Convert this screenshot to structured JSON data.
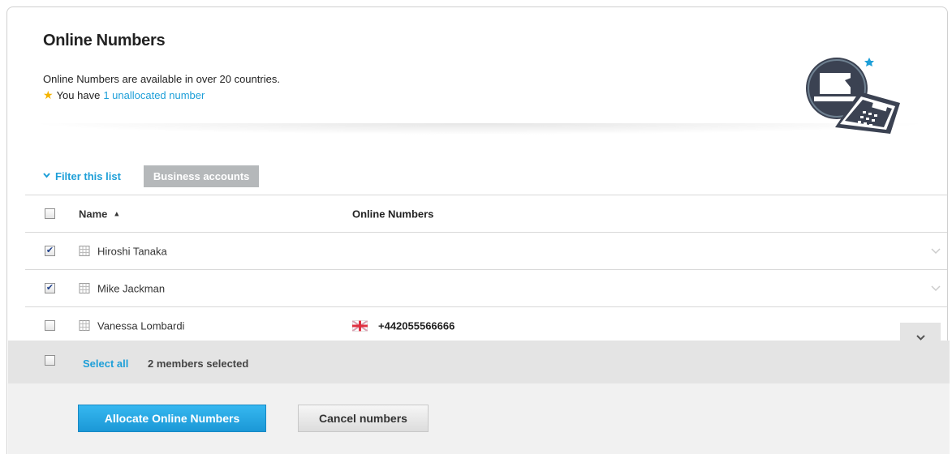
{
  "header": {
    "title": "Online Numbers",
    "description": "Online Numbers are available in over 20 countries.",
    "unallocated_prefix": "You have",
    "unallocated_link": "1 unallocated number"
  },
  "filter": {
    "label": "Filter this list",
    "tag": "Business accounts"
  },
  "table": {
    "columns": {
      "name": "Name",
      "numbers": "Online Numbers"
    },
    "rows": [
      {
        "name": "Hiroshi Tanaka",
        "checked": true,
        "number": ""
      },
      {
        "name": "Mike Jackman",
        "checked": true,
        "number": ""
      },
      {
        "name": "Vanessa Lombardi",
        "checked": false,
        "number": "+442055566666",
        "flag": "uk-flag"
      }
    ]
  },
  "selection": {
    "select_all": "Select all",
    "selected_count": "2 members selected"
  },
  "actions": {
    "allocate": "Allocate Online Numbers",
    "cancel": "Cancel numbers"
  },
  "colors": {
    "accent": "#1e9fd8",
    "pill": "#b5b8ba",
    "star": "#f5b400",
    "icon_dark": "#3b4252"
  },
  "icons": {
    "hero": "phone-computer-illustration",
    "star": "star-icon",
    "building": "building-icon"
  }
}
